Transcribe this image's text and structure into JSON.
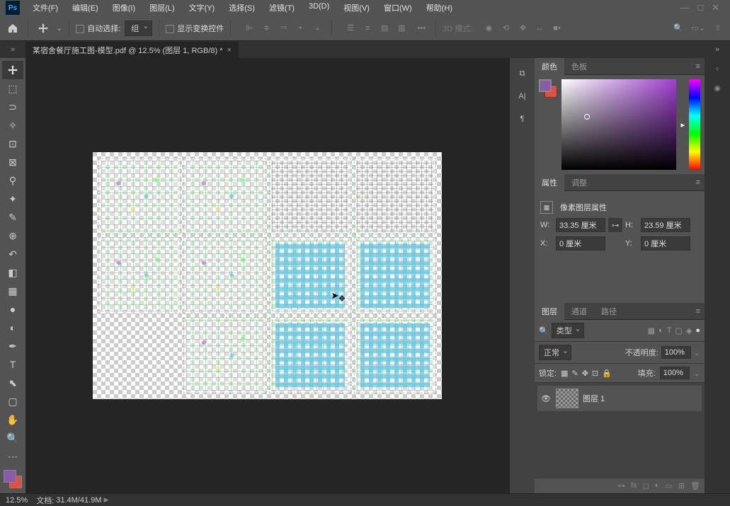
{
  "menu": {
    "file": "文件(F)",
    "edit": "编辑(E)",
    "image": "图像(I)",
    "layer": "图层(L)",
    "type": "文字(Y)",
    "select": "选择(S)",
    "filter": "滤镜(T)",
    "threed": "3D(D)",
    "view": "视图(V)",
    "window": "窗口(W)",
    "help": "帮助(H)"
  },
  "options": {
    "auto_select": "自动选择:",
    "auto_select_value": "组",
    "show_transform": "显示变换控件",
    "mode3d_label": "3D 模式:"
  },
  "document": {
    "tab_title": "某宿舍餐厅施工图-模型.pdf @ 12.5% (图层 1, RGB/8) *"
  },
  "panels": {
    "color_tab": "颜色",
    "swatches_tab": "色板",
    "properties_tab": "属性",
    "adjust_tab": "调整",
    "layers_tab": "图层",
    "channels_tab": "通道",
    "paths_tab": "路径"
  },
  "properties": {
    "title": "像素图层属性",
    "w_label": "W:",
    "w_value": "33.35 厘米",
    "h_label": "H:",
    "h_value": "23.59 厘米",
    "x_label": "X:",
    "x_value": "0 厘米",
    "y_label": "Y:",
    "y_value": "0 厘米"
  },
  "layers": {
    "kind_label": "类型",
    "blend_mode": "正常",
    "opacity_label": "不透明度:",
    "opacity_value": "100%",
    "lock_label": "锁定:",
    "fill_label": "填充:",
    "fill_value": "100%",
    "layer1_name": "图层 1"
  },
  "status": {
    "zoom": "12.5%",
    "doc_label": "文档:",
    "doc_size": "31.4M/41.9M"
  }
}
